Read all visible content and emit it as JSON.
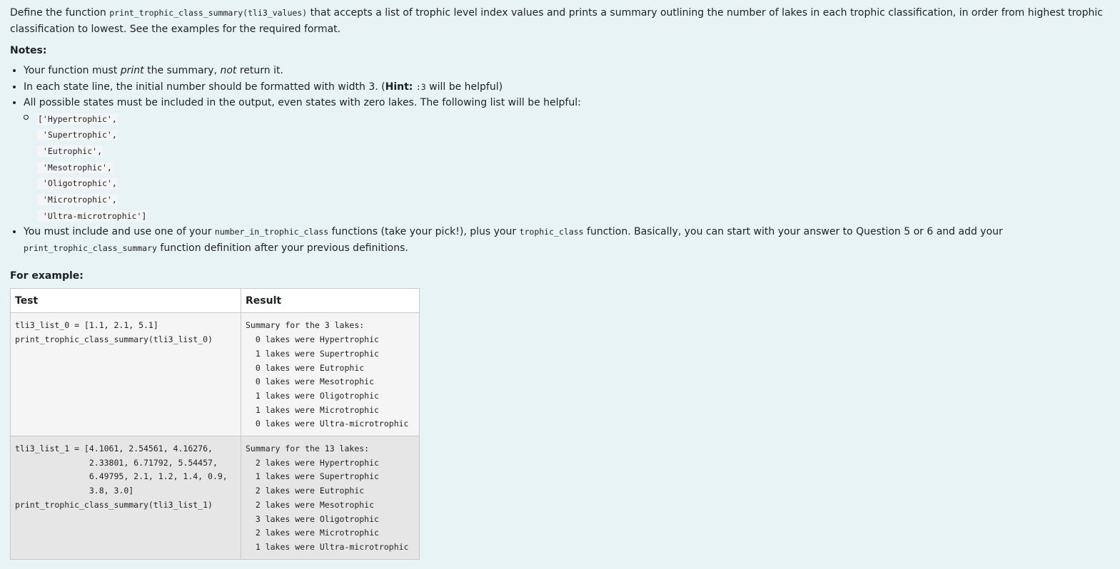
{
  "intro": {
    "before": "Define the function ",
    "function_sig": "print_trophic_class_summary(tli3_values)",
    "after": " that accepts a list of trophic level index values and prints a summary outlining the number of lakes in each trophic classification, in order from highest trophic classification to lowest. See the examples for the required format."
  },
  "notes": {
    "label": "Notes:",
    "item1": {
      "before": "Your function must ",
      "em1": "print",
      "middle": " the summary, ",
      "em2": "not",
      "after": " return it."
    },
    "item2": {
      "before": "In each state line, the initial number should be formatted with width 3. (",
      "hint": "Hint:",
      "space": " ",
      "code": ":3",
      "after": " will be helpful)"
    },
    "item3": {
      "text": "All possible states must be included in the output, even states with zero lakes. The following list will be helpful:",
      "states": [
        "['Hypertrophic',",
        " 'Supertrophic',",
        " 'Eutrophic',",
        " 'Mesotrophic',",
        " 'Oligotrophic',",
        " 'Microtrophic',",
        " 'Ultra-microtrophic']"
      ]
    },
    "item4": {
      "part1": "You must include and use one of your ",
      "code1": "number_in_trophic_class",
      "part2": " functions (take your pick!), plus your ",
      "code2": "trophic_class",
      "part3": " function. Basically, you can start with your answer to Question 5 or 6 and add your ",
      "code3": "print_trophic_class_summary",
      "part4": " function definition after your previous definitions."
    }
  },
  "examples": {
    "label": "For example:",
    "headers": [
      "Test",
      "Result"
    ],
    "rows": [
      {
        "test": "tli3_list_0 = [1.1, 2.1, 5.1]\nprint_trophic_class_summary(tli3_list_0)",
        "result": "Summary for the 3 lakes:\n  0 lakes were Hypertrophic\n  1 lakes were Supertrophic\n  0 lakes were Eutrophic\n  0 lakes were Mesotrophic\n  1 lakes were Oligotrophic\n  1 lakes were Microtrophic\n  0 lakes were Ultra-microtrophic"
      },
      {
        "test": "tli3_list_1 = [4.1061, 2.54561, 4.16276,\n               2.33801, 6.71792, 5.54457,\n               6.49795, 2.1, 1.2, 1.4, 0.9,\n               3.8, 3.0]\nprint_trophic_class_summary(tli3_list_1)",
        "result": "Summary for the 13 lakes:\n  2 lakes were Hypertrophic\n  1 lakes were Supertrophic\n  2 lakes were Eutrophic\n  2 lakes were Mesotrophic\n  3 lakes were Oligotrophic\n  2 lakes were Microtrophic\n  1 lakes were Ultra-microtrophic"
      }
    ]
  }
}
